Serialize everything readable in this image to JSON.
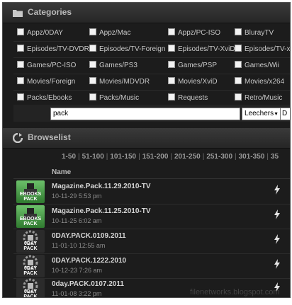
{
  "categories": {
    "title": "Categories",
    "icon": "folder-icon",
    "items": [
      [
        "Appz/0DAY",
        "Appz/Mac",
        "Appz/PC-ISO",
        "BlurayTV"
      ],
      [
        "Episodes/TV-DVDR",
        "Episodes/TV-Foreign",
        "Episodes/TV-XviD",
        "Episodes/TV-x"
      ],
      [
        "Games/PC-ISO",
        "Games/PS3",
        "Games/PSP",
        "Games/Wii"
      ],
      [
        "Movies/Foreign",
        "Movies/MDVDR",
        "Movies/XviD",
        "Movies/x264"
      ],
      [
        "Packs/Ebooks",
        "Packs/Music",
        "Requests",
        "Retro/Music"
      ]
    ]
  },
  "search": {
    "value": "pack",
    "sort_value": "Leechers",
    "extra_value": "D"
  },
  "browselist": {
    "title": "Browselist",
    "icon": "refresh-icon",
    "pages": [
      "1-50",
      "51-100",
      "101-150",
      "151-200",
      "201-250",
      "251-300",
      "301-350",
      "35"
    ],
    "column_name": "Name",
    "rows": [
      {
        "name": "Magazine.Pack.11.29.2010-TV",
        "date": "10-11-29 5:53 pm",
        "thumb": "EBOOKS PACK",
        "kind": "ebook"
      },
      {
        "name": "Magazine.Pack.11.25.2010-TV",
        "date": "10-11-25 6:02 am",
        "thumb": "EBOOKS PACK",
        "kind": "ebook"
      },
      {
        "name": "0DAY.PACK.0109.2011",
        "date": "11-01-10 12:55 am",
        "thumb": "0DAY PACK",
        "kind": "oday"
      },
      {
        "name": "0DAY.PACK.1222.2010",
        "date": "10-12-23 7:26 am",
        "thumb": "0DAY PACK",
        "kind": "oday"
      },
      {
        "name": "0day.PACK.0107.2011",
        "date": "11-01-08 3:22 pm",
        "thumb": "0DAY PACK",
        "kind": "oday"
      }
    ],
    "download_icon": "lightning-bolt-icon"
  },
  "watermark": "filenetworks.blogspot.com",
  "colors": {
    "background": "#1c1c1c",
    "header": "#2f2f2f",
    "text": "#c8c8c8",
    "ebook_thumb": "#4a9e48"
  }
}
